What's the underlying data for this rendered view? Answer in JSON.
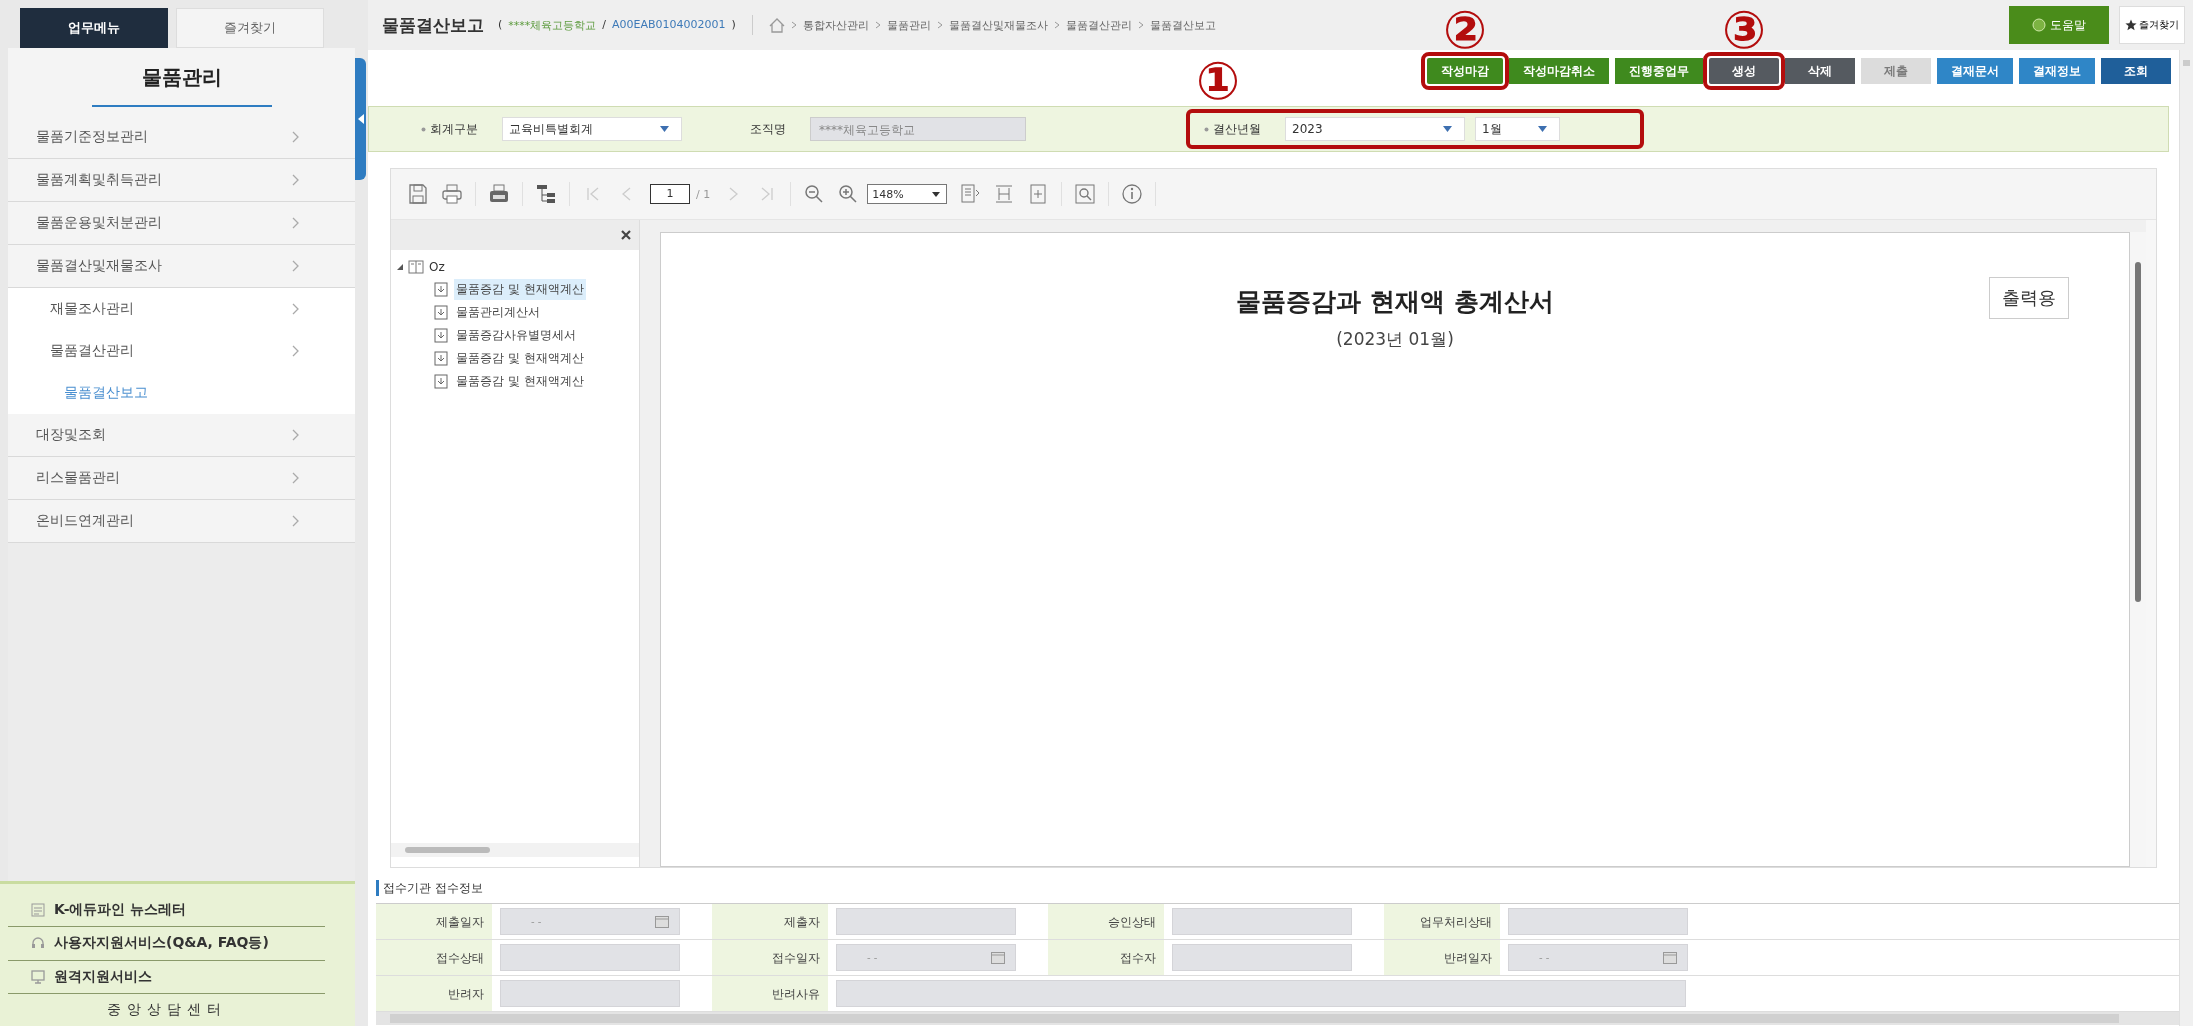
{
  "sidebar": {
    "tabs": [
      {
        "label": "업무메뉴",
        "selected": true
      },
      {
        "label": "즐겨찾기",
        "selected": false
      }
    ],
    "title": "물품관리",
    "menu": [
      {
        "label": "물품기준정보관리",
        "kind": "group",
        "selected": false
      },
      {
        "label": "물품계획및취득관리",
        "kind": "group",
        "selected": false
      },
      {
        "label": "물품운용및처분관리",
        "kind": "group",
        "selected": false
      },
      {
        "label": "물품결산및재물조사",
        "kind": "group",
        "selected": false,
        "children": [
          {
            "label": "재물조사관리",
            "kind": "group",
            "selected": false
          },
          {
            "label": "물품결산관리",
            "kind": "group",
            "selected": false,
            "children": [
              {
                "label": "물품결산보고",
                "kind": "page",
                "selected": true
              }
            ]
          }
        ]
      },
      {
        "label": "대장및조회",
        "kind": "group",
        "selected": false
      },
      {
        "label": "리스물품관리",
        "kind": "group",
        "selected": false
      },
      {
        "label": "온비드연계관리",
        "kind": "group",
        "selected": false
      }
    ],
    "links": [
      {
        "label": "K-에듀파인 뉴스레터",
        "kind": "newsletter"
      },
      {
        "label": "사용자지원서비스(Q&A, FAQ등)",
        "kind": "support"
      },
      {
        "label": "원격지원서비스",
        "kind": "remote"
      },
      {
        "label": "중앙상담센터",
        "kind": "plain"
      }
    ]
  },
  "header": {
    "title": "물품결산보고",
    "context": [
      {
        "text": "(",
        "kind": "punct"
      },
      {
        "text": "****체육고등학교",
        "kind": "org"
      },
      {
        "text": "/",
        "kind": "punct"
      },
      {
        "text": "A00EAB0104002001",
        "kind": "code"
      },
      {
        "text": ")",
        "kind": "punct"
      }
    ],
    "breadcrumb": [
      "통합자산관리",
      "물품관리",
      "물품결산및재물조사",
      "물품결산관리",
      "물품결산보고"
    ],
    "help": "도움말",
    "favorite": "즐겨찾기"
  },
  "buttons": [
    {
      "label": "작성마감",
      "kind": "green",
      "highlighted": true,
      "callout": "②"
    },
    {
      "label": "작성마감취소",
      "kind": "green",
      "highlighted": false
    },
    {
      "label": "진행중업무",
      "kind": "green",
      "highlighted": false
    },
    {
      "label": "생성",
      "kind": "dark",
      "highlighted": true,
      "callout": "③"
    },
    {
      "label": "삭제",
      "kind": "dark",
      "highlighted": false
    },
    {
      "label": "제출",
      "kind": "disabled",
      "highlighted": false
    },
    {
      "label": "결재문서",
      "kind": "blue",
      "highlighted": false
    },
    {
      "label": "결재정보",
      "kind": "blue",
      "highlighted": false
    },
    {
      "label": "조회",
      "kind": "navy",
      "highlighted": false
    }
  ],
  "filter": [
    {
      "label": "회계구분",
      "required": true,
      "kind": "select",
      "values": [
        "교육비특별회계"
      ],
      "highlighted": false
    },
    {
      "label": "조직명",
      "required": false,
      "kind": "readonly",
      "values": [
        "****체육고등학교"
      ],
      "highlighted": false
    },
    {
      "label": "결산년월",
      "required": true,
      "kind": "select",
      "values": [
        "2023",
        "1월"
      ],
      "highlighted": true,
      "callout": "①"
    }
  ],
  "viewer": {
    "toolbar": {
      "page": "1",
      "total": "/ 1",
      "zoom": "148%"
    },
    "tree": {
      "label": "Oz",
      "expanded": true,
      "children": [
        {
          "label": "물품증감 및 현재액계산",
          "selected": true
        },
        {
          "label": "물품관리계산서",
          "selected": false
        },
        {
          "label": "물품증감사유별명세서",
          "selected": false
        },
        {
          "label": "물품증감 및 현재액계산",
          "selected": false
        },
        {
          "label": "물품증감 및 현재액계산",
          "selected": false
        }
      ]
    },
    "document": {
      "title": "물품증감과 현재액 총계산서",
      "period": "(2023년 01월)",
      "stamp": "출력용"
    }
  },
  "reception": {
    "heading": "접수기관 접수정보",
    "rows": [
      [
        {
          "label": "제출일자",
          "kind": "date",
          "value": "- -"
        },
        {
          "label": "제출자",
          "kind": "text"
        },
        {
          "label": "승인상태",
          "kind": "text"
        },
        {
          "label": "업무처리상태",
          "kind": "text"
        }
      ],
      [
        {
          "label": "접수상태",
          "kind": "text"
        },
        {
          "label": "접수일자",
          "kind": "date",
          "value": "- -"
        },
        {
          "label": "접수자",
          "kind": "text"
        },
        {
          "label": "반려일자",
          "kind": "date",
          "value": "- -"
        }
      ],
      [
        {
          "label": "반려자",
          "kind": "text"
        },
        {
          "label": "반려사유",
          "kind": "wide"
        }
      ]
    ]
  }
}
